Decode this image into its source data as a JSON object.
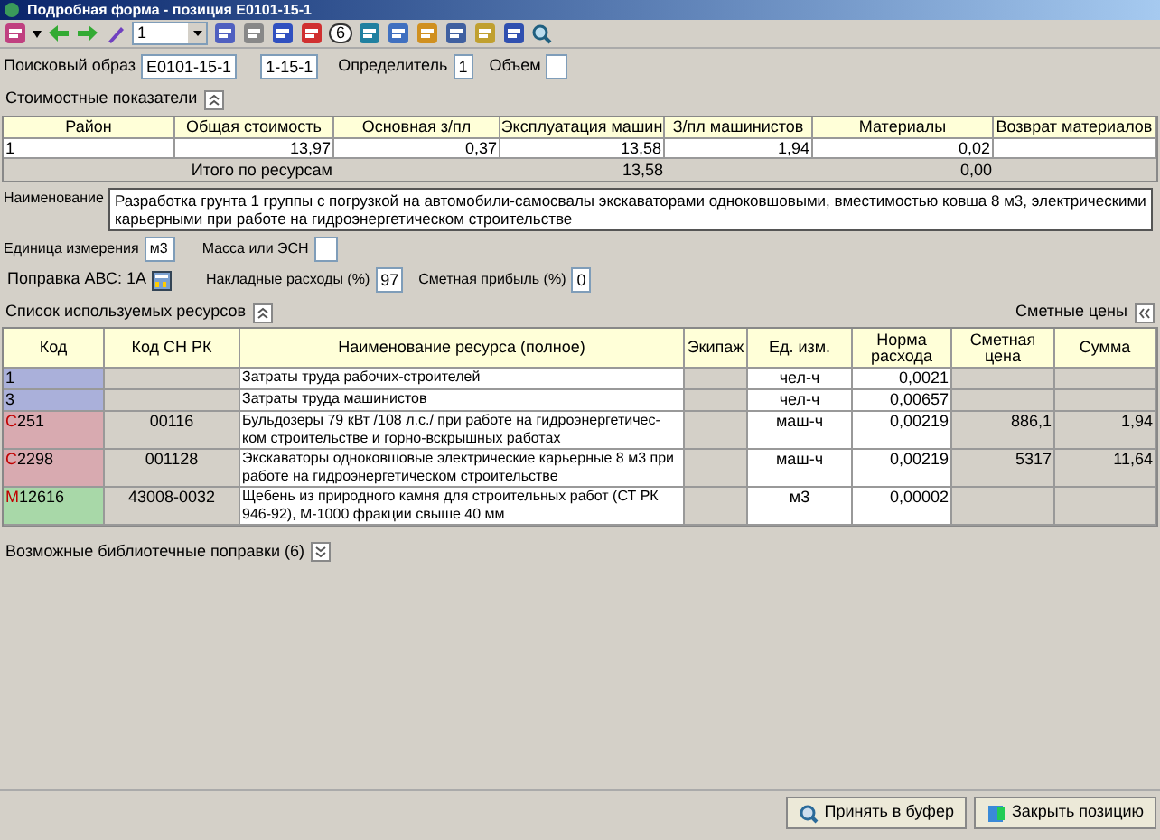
{
  "window": {
    "title": "Подробная форма - позиция E0101-15-1"
  },
  "toolbar": {
    "selector_value": "1",
    "badge": "6"
  },
  "search": {
    "label": "Поисковый образ",
    "value": "E0101-15-1",
    "code": "1-15-1",
    "determinant_label": "Определитель",
    "determinant": "1",
    "volume_label": "Объем"
  },
  "cost_section": {
    "title": "Стоимостные показатели",
    "expanded": true
  },
  "cost_table": {
    "columns": [
      "Район",
      "Общая стоимость",
      "Основная з/пл",
      "Эксплуатация машин",
      "З/пл машинистов",
      "Материалы",
      "Возврат материалов"
    ],
    "rows": [
      [
        "1",
        "13,97",
        "0,37",
        "13,58",
        "1,94",
        "0,02",
        ""
      ]
    ],
    "total": {
      "label": "Итого по ресурсам",
      "machines": "13,58",
      "materials": "0,00"
    }
  },
  "name": {
    "label": "Наименование",
    "value": "Разработка грунта 1 группы с погрузкой на автомобили-самосвалы экскаваторами одноковшовыми, вместимостью ковша 8 м3, электрическими карьерными при работе на гидроэнергетическом строительстве"
  },
  "unit": {
    "label": "Единица измерения",
    "value": "м3",
    "mass_label": "Масса или ЭСН"
  },
  "correction": {
    "label": "Поправка АВС: 1А",
    "overhead_label": "Накладные расходы (%)",
    "overhead": "97",
    "profit_label": "Сметная прибыль (%)",
    "profit": "0"
  },
  "resources": {
    "title": "Список используемых ресурсов",
    "expanded": true,
    "prices_label": "Сметные цены",
    "columns": [
      "Код",
      "Код СН РК",
      "Наименование ресурса (полное)",
      "Экипаж",
      "Ед. изм.",
      "Норма расхода",
      "Сметная цена",
      "Сумма"
    ],
    "rows": [
      {
        "prefix": "",
        "code": "1",
        "color": "#aab0da",
        "cn": "",
        "name": "Затраты труда рабочих-строителей",
        "unit": "чел-ч",
        "norm": "0,0021",
        "price": "",
        "sum": ""
      },
      {
        "prefix": "",
        "code": "3",
        "color": "#aab0da",
        "cn": "",
        "name": "Затраты труда машинистов",
        "unit": "чел-ч",
        "norm": "0,00657",
        "price": "",
        "sum": ""
      },
      {
        "prefix": "С",
        "code": "251",
        "color": "#d8aab0",
        "cn": "00116",
        "name": "Бульдозеры 79 кВт /108 л.с./ при работе на гидроэнергетичес-ком строительстве и горно-вскрышных работах",
        "unit": "маш-ч",
        "norm": "0,00219",
        "price": "886,1",
        "sum": "1,94"
      },
      {
        "prefix": "С",
        "code": "2298",
        "color": "#d8aab0",
        "cn": "001128",
        "name": "Экскаваторы одноковшовые электрические карьерные 8 м3 при работе на гидроэнергетическом строительстве",
        "unit": "маш-ч",
        "norm": "0,00219",
        "price": "5317",
        "sum": "11,64"
      },
      {
        "prefix": "М",
        "code": "12616",
        "color": "#a8d8a8",
        "cn": "43008-0032",
        "name": "Щебень из природного камня для строительных работ (СТ РК 946-92), М-1000 фракции свыше 40 мм",
        "unit": "м3",
        "norm": "0,00002",
        "price": "",
        "sum": ""
      }
    ]
  },
  "library": {
    "title": "Возможные библиотечные поправки (6)",
    "expanded": false
  },
  "buttons": [
    {
      "label": "Принять в буфер",
      "kind": "accept"
    },
    {
      "label": "Закрыть позицию",
      "kind": "close"
    }
  ]
}
